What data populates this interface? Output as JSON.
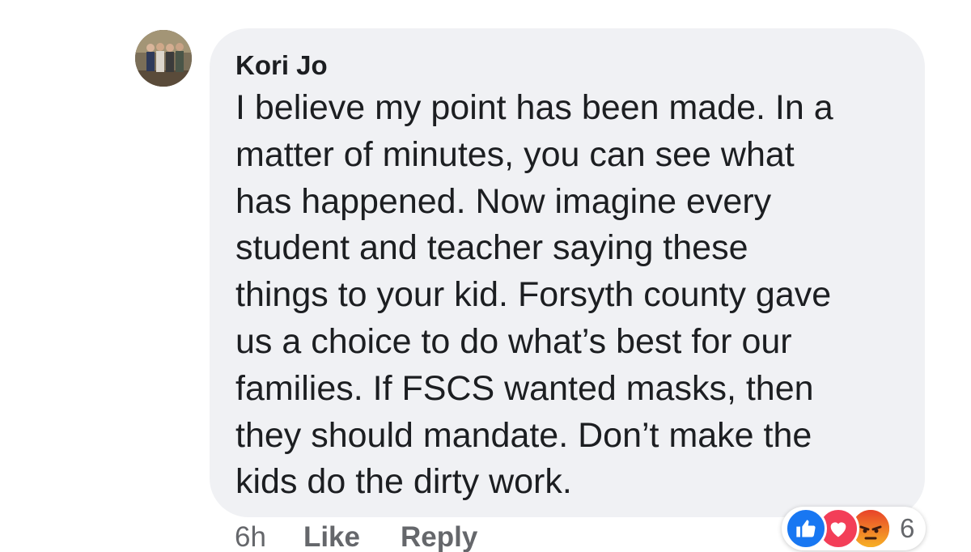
{
  "comment": {
    "author": "Kori Jo",
    "text": "I believe my point has been made. In a\nmatter of minutes, you can see what\nhas happened. Now imagine every\nstudent and teacher saying these\nthings to your kid. Forsyth county gave\nus a choice to do what’s best for our\nfamilies.  If FSCS wanted masks, then\nthey should mandate. Don’t make the\nkids do the dirty work.",
    "timestamp": "6h",
    "like_label": "Like",
    "reply_label": "Reply"
  },
  "reactions": {
    "icons": [
      "like-icon",
      "love-icon",
      "angry-icon"
    ],
    "count": "6"
  },
  "colors": {
    "bubble": "#f0f1f4",
    "text": "#1c1e21",
    "meta": "#65676b",
    "like": "#1877f2",
    "love": "#f33e58",
    "angry": "#e9710f"
  }
}
